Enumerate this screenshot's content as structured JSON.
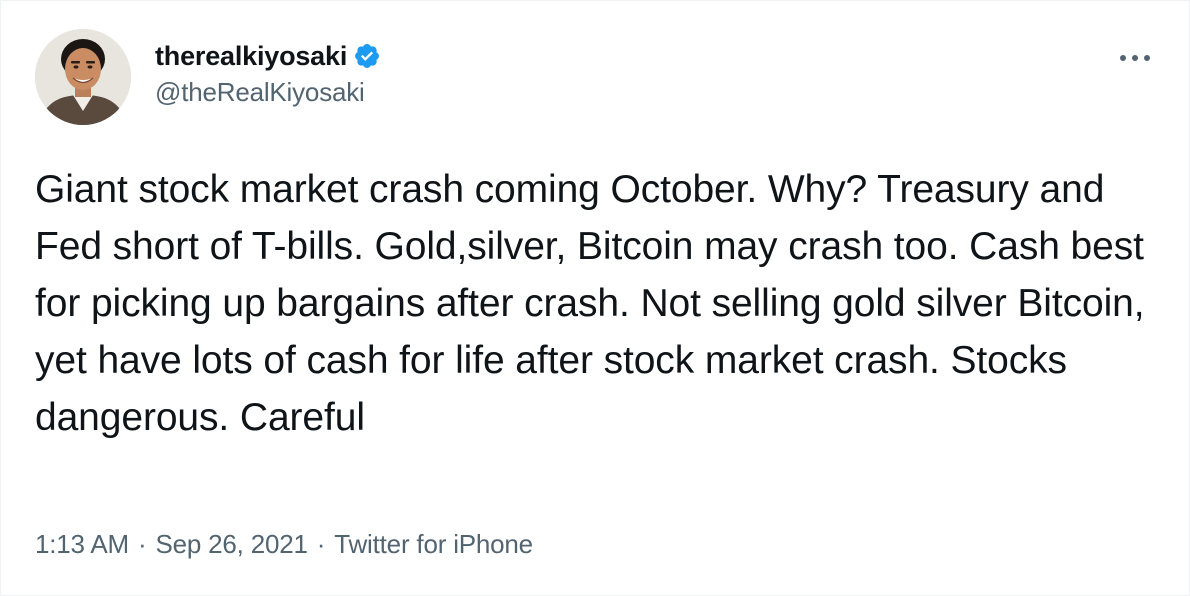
{
  "author": {
    "display_name": "therealkiyosaki",
    "handle": "@theRealKiyosaki",
    "verified": true,
    "avatar_icon": "user-avatar-photo"
  },
  "menu": {
    "icon": "more-horizontal-icon"
  },
  "tweet": {
    "text": "Giant stock market crash coming October. Why? Treasury and Fed short of T-bills. Gold,silver, Bitcoin may crash too. Cash best for picking up bargains after crash. Not selling gold silver Bitcoin, yet have lots of cash for life after stock market crash. Stocks dangerous. Careful"
  },
  "meta": {
    "time": "1:13 AM",
    "separator": "·",
    "date": "Sep 26, 2021",
    "source": "Twitter for iPhone"
  },
  "colors": {
    "text_primary": "#0f1419",
    "text_secondary": "#536471",
    "verified_blue": "#1d9bf0"
  }
}
